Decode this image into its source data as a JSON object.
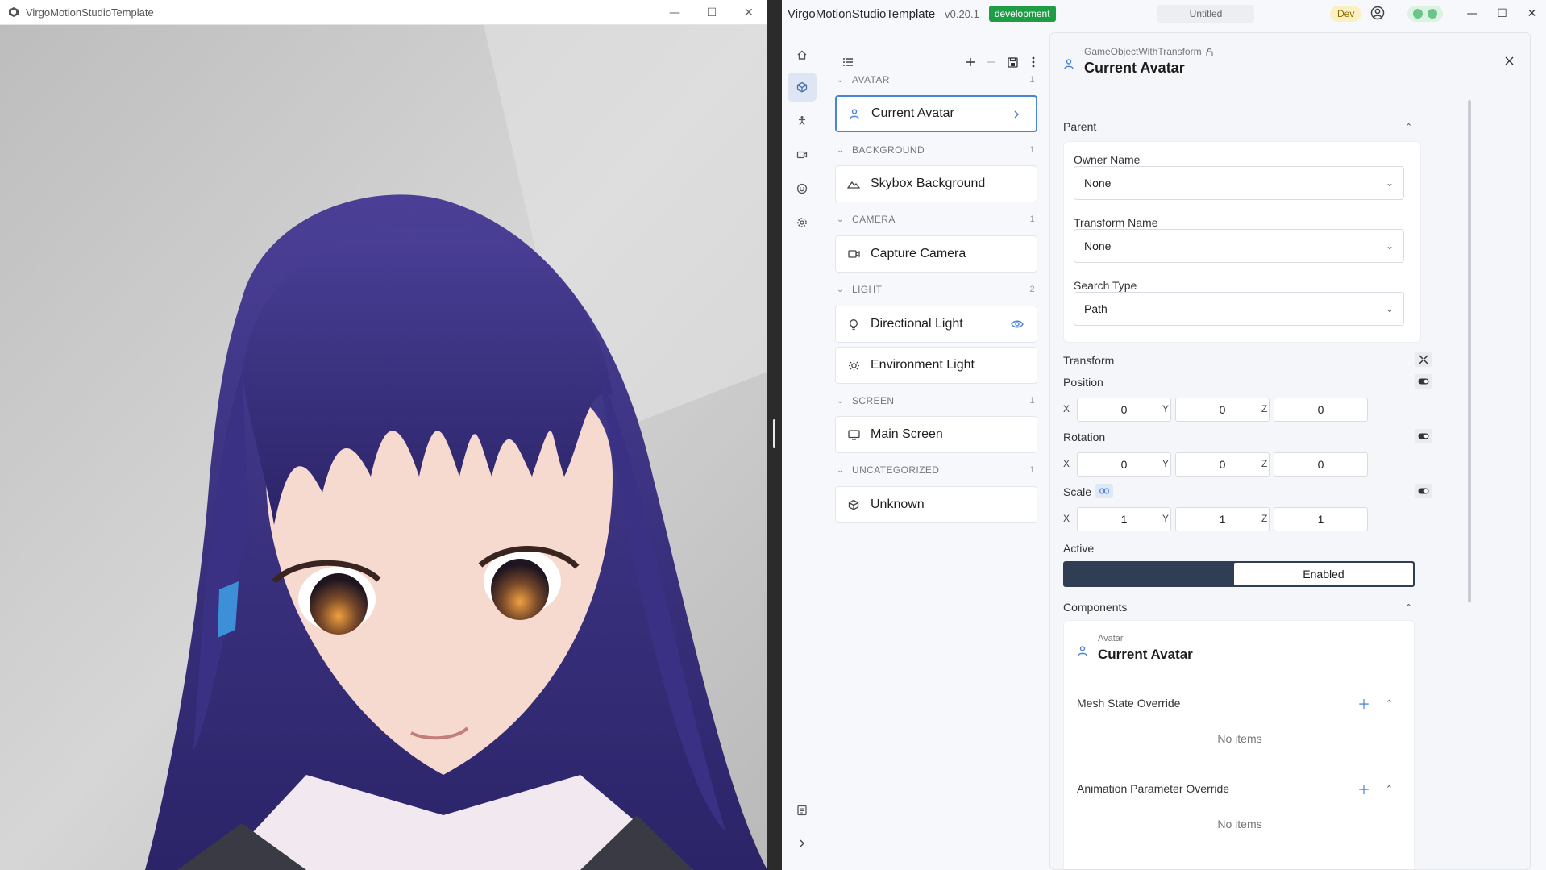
{
  "viewer": {
    "title": "VirgoMotionStudioTemplate",
    "controls": [
      "—",
      "☐",
      "✕"
    ]
  },
  "app": {
    "name": "VirgoMotionStudioTemplate",
    "version": "v0.20.1",
    "env_badge": "development",
    "document": "Untitled",
    "dev_badge": "Dev",
    "controls": [
      "—",
      "☐",
      "✕"
    ],
    "accent_color": "#4a84d6",
    "env_color": "#1f9d45"
  },
  "nav": {
    "items": [
      "home-icon",
      "cube-icon",
      "figure-icon",
      "camera-icon",
      "face-icon",
      "gear-icon"
    ],
    "bottom": [
      "list-icon",
      "chevron-right-icon"
    ]
  },
  "scene": {
    "groups": [
      {
        "name": "AVATAR",
        "count": "1",
        "items": [
          {
            "label": "Current Avatar",
            "icon": "person-icon"
          }
        ]
      },
      {
        "name": "BACKGROUND",
        "count": "1",
        "items": [
          {
            "label": "Skybox Background",
            "icon": "mountain-icon"
          }
        ]
      },
      {
        "name": "CAMERA",
        "count": "1",
        "items": [
          {
            "label": "Capture Camera",
            "icon": "video-icon"
          }
        ]
      },
      {
        "name": "LIGHT",
        "count": "2",
        "items": [
          {
            "label": "Directional Light",
            "icon": "bulb-icon"
          },
          {
            "label": "Environment Light",
            "icon": "sun-icon"
          }
        ]
      },
      {
        "name": "SCREEN",
        "count": "1",
        "items": [
          {
            "label": "Main Screen",
            "icon": "monitor-icon"
          }
        ]
      },
      {
        "name": "UNCATEGORIZED",
        "count": "1",
        "items": [
          {
            "label": "Unknown",
            "icon": "cube-icon"
          }
        ]
      }
    ]
  },
  "inspector": {
    "type": "GameObjectWithTransform",
    "title": "Current Avatar",
    "parent": {
      "label": "Parent",
      "owner_name_label": "Owner Name",
      "owner_name_value": "None",
      "transform_name_label": "Transform Name",
      "transform_name_value": "None",
      "search_type_label": "Search Type",
      "search_type_value": "Path"
    },
    "transform": {
      "label": "Transform",
      "position_label": "Position",
      "position": {
        "x": "0",
        "y": "0",
        "z": "0"
      },
      "rotation_label": "Rotation",
      "rotation": {
        "x": "0",
        "y": "0",
        "z": "0"
      },
      "scale_label": "Scale",
      "scale": {
        "x": "1",
        "y": "1",
        "z": "1"
      },
      "axis": {
        "x": "X",
        "y": "Y",
        "z": "Z"
      }
    },
    "active": {
      "label": "Active",
      "value": "Enabled"
    },
    "components": {
      "label": "Components",
      "avatar_type": "Avatar",
      "avatar_title": "Current Avatar",
      "mesh_state_label": "Mesh State Override",
      "mesh_state_empty": "No items",
      "anim_param_label": "Animation Parameter Override",
      "anim_param_empty": "No items"
    }
  }
}
